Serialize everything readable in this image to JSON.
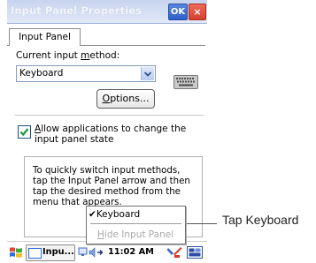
{
  "window": {
    "title": "Input Panel Properties",
    "ok_label": "OK",
    "close_label": "×"
  },
  "tabs": [
    {
      "label": "Input Panel"
    }
  ],
  "input_method": {
    "label_before": "Current input ",
    "label_accel": "m",
    "label_after": "ethod:",
    "value": "Keyboard"
  },
  "options_button": {
    "accel": "O",
    "label_rest": "ptions..."
  },
  "allow_checkbox": {
    "checked": true,
    "accel": "A",
    "label_rest": "llow applications to change the input panel state"
  },
  "info_text": "To quickly switch input methods, tap the Input Panel arrow and then tap the desired method from the menu that appears.",
  "popup_menu": {
    "items": [
      {
        "check": "✔",
        "label": "Keyboard",
        "enabled": true
      },
      {
        "accel": "H",
        "label_rest": "ide Input Panel",
        "enabled": false
      }
    ]
  },
  "taskbar": {
    "app_label": "Inpu...",
    "time": "11:02 AM"
  },
  "callout": {
    "text": "Tap Keyboard"
  },
  "icons": [
    "windows-start-icon",
    "app-window-icon",
    "network-tray-icon",
    "speaker-tray-icon",
    "tools-icon",
    "keyboard-icon",
    "dropdown-arrow-icon",
    "checkmark-icon"
  ],
  "colors": {
    "title_bar": "#c7d4ef",
    "ok_button": "#3a68d0",
    "close_button": "#d3412f",
    "checkbox_check": "#1f9a3a"
  }
}
